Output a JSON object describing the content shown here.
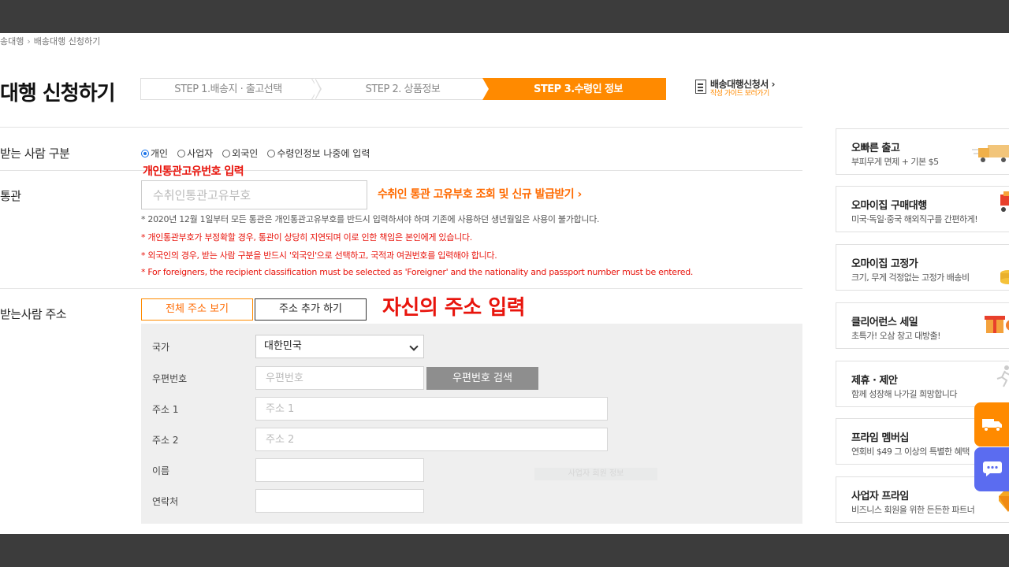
{
  "breadcrumb": [
    "송대행",
    "배송대행 신청하기"
  ],
  "page_title": "대행 신청하기",
  "steps": [
    {
      "label": "STEP 1.배송지 · 출고선택"
    },
    {
      "label": "STEP 2. 상품정보"
    },
    {
      "label": "STEP 3.수령인 정보"
    }
  ],
  "guide": {
    "title": "배송대행신청서 ›",
    "subtitle": "작성 가이드 보러가기"
  },
  "recipient_type": {
    "label": "받는 사람 구분",
    "options": [
      "개인",
      "사업자",
      "외국인",
      "수령인정보 나중에 입력"
    ],
    "selected": "개인"
  },
  "annotations": {
    "customs_hint": "개인통관고유번호 입력",
    "address_hint": "자신의 주소 입력"
  },
  "customs": {
    "label": "통관",
    "placeholder": "수취인통관고유부호",
    "link": "수취인 통관 고유부호 조회 및 신규 발급받기  ›",
    "notes": [
      "* 2020년 12월 1일부터 모든 통관은 개인통관고유부호를 반드시 입력하셔야 하며 기존에 사용하던 생년월일은 사용이 불가합니다.",
      "* 개인통관부호가 부정확할 경우, 통관이 상당히 지연되며 이로 인한 책임은 본인에게 있습니다.",
      "* 외국인의 경우, 받는 사람 구분을 반드시 '외국인'으로 선택하고, 국적과 여권번호를 입력해야 합니다.",
      "* For foreigners, the recipient classification must be selected as 'Foreigner' and the nationality and passport number must be entered."
    ]
  },
  "address": {
    "label": "받는사람 주소",
    "view_all": "전체 주소 보기",
    "add": "주소 추가 하기",
    "fields": {
      "country_label": "국가",
      "country_value": "대한민국",
      "zip_label": "우편번호",
      "zip_placeholder": "우편번호",
      "zip_search": "우편번호 검색",
      "addr1_label": "주소 1",
      "addr1_placeholder": "주소 1",
      "addr2_label": "주소 2",
      "addr2_placeholder": "주소 2",
      "name_label": "이름",
      "phone_label": "연락처",
      "faded_button": "사업자 회원 정보"
    }
  },
  "sidebar": [
    {
      "title": "오빠른 출고",
      "desc": "부피무게 면제 + 기본 $5",
      "icon": "truck-icon"
    },
    {
      "title": "오마이집 구매대행",
      "desc": "미국·독일·중국 해외직구를 간편하게!",
      "icon": "cart-icon"
    },
    {
      "title": "오마이집 고정가",
      "desc": "크기, 무게 걱정없는 고정가 배송비",
      "icon": "coins-icon"
    },
    {
      "title": "클리어런스 세일",
      "desc": "초특가! 오삼 창고 대방출!",
      "icon": "gift-icon"
    },
    {
      "title": "제휴 · 제안",
      "desc": "함께 성장해 나가길 희망합니다",
      "icon": "runner-icon"
    },
    {
      "title": "프라임 멤버십",
      "desc": "연회비 $49 그 이상의 특별한 혜택",
      "icon": "crown-icon"
    },
    {
      "title": "사업자 프라임",
      "desc": "비즈니스 회원을 위한 든든한 파트너",
      "icon": "diamond-icon"
    }
  ],
  "colors": {
    "accent": "#ff8a00",
    "alert": "#e8140c",
    "chat": "#5b6cf0"
  }
}
